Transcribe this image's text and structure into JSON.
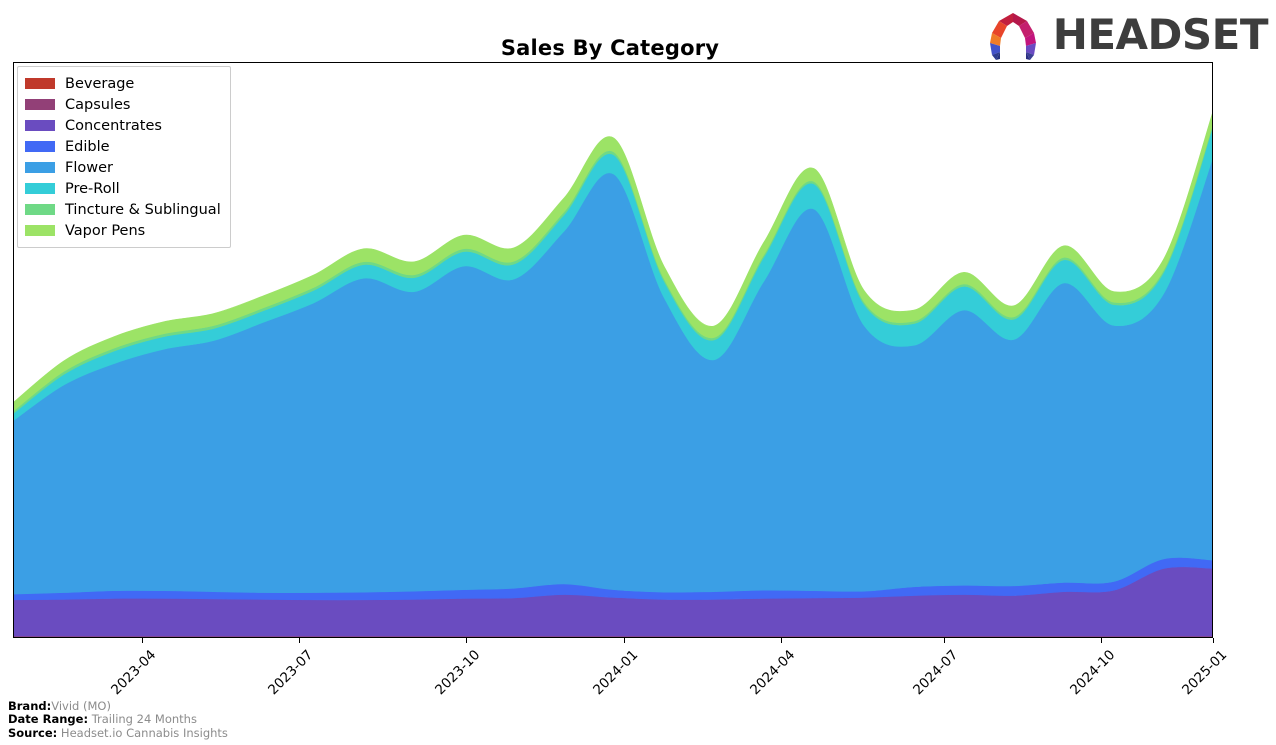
{
  "header": {
    "title": "Sales By Category",
    "logo_word": "HEADSET",
    "logo_icon": "headset-arch-logo"
  },
  "legend": {
    "position": "top-left",
    "items": [
      {
        "label": "Beverage",
        "color": "#c0392b"
      },
      {
        "label": "Capsules",
        "color": "#924077"
      },
      {
        "label": "Concentrates",
        "color": "#6a4cc0"
      },
      {
        "label": "Edible",
        "color": "#4169f5"
      },
      {
        "label": "Flower",
        "color": "#3b9fe5"
      },
      {
        "label": "Pre-Roll",
        "color": "#34cdd8"
      },
      {
        "label": "Tincture & Sublingual",
        "color": "#6fd986"
      },
      {
        "label": "Vapor Pens",
        "color": "#9ce366"
      }
    ]
  },
  "axis": {
    "x_ticks": [
      {
        "label": "2023-04",
        "pos": 0.1072
      },
      {
        "label": "2023-07",
        "pos": 0.2383
      },
      {
        "label": "2023-10",
        "pos": 0.3778
      },
      {
        "label": "2024-01",
        "pos": 0.5089
      },
      {
        "label": "2024-04",
        "pos": 0.64
      },
      {
        "label": "2024-07",
        "pos": 0.7756
      },
      {
        "label": "2024-10",
        "pos": 0.9067
      },
      {
        "label": "2025-01",
        "pos": 1.0
      }
    ],
    "y_labels_visible": false,
    "grid": false
  },
  "footer": {
    "rows": [
      {
        "key": "Brand:",
        "value": "Vivid (MO)"
      },
      {
        "key": "Date Range:",
        "value": "Trailing 24 Months"
      },
      {
        "key": "Source:",
        "value": "Headset.io Cannabis Insights"
      }
    ]
  },
  "chart_data": {
    "type": "area",
    "stacked": true,
    "smoothing": "spline",
    "title": "Sales By Category",
    "xlabel": "",
    "ylabel": "",
    "ylim": [
      0,
      100
    ],
    "axis_values_hidden": true,
    "x": [
      "2023-01",
      "2023-02",
      "2023-03",
      "2023-04",
      "2023-05",
      "2023-06",
      "2023-07",
      "2023-08",
      "2023-09",
      "2023-10",
      "2023-11",
      "2023-12",
      "2024-01",
      "2024-02",
      "2024-03",
      "2024-04",
      "2024-05",
      "2024-06",
      "2024-07",
      "2024-08",
      "2024-09",
      "2024-10",
      "2024-11",
      "2024-12",
      "2025-01"
    ],
    "series": [
      {
        "name": "Beverage",
        "color": "#c0392b",
        "values": [
          0.4,
          0.4,
          0.4,
          0.4,
          0.4,
          0.4,
          0.4,
          0.4,
          0.4,
          0.4,
          0.4,
          0.4,
          0.4,
          0.4,
          0.4,
          0.4,
          0.4,
          0.4,
          0.4,
          0.4,
          0.4,
          0.4,
          0.4,
          0.4,
          0.4
        ]
      },
      {
        "name": "Capsules",
        "color": "#924077",
        "values": [
          0.2,
          0.2,
          0.2,
          0.2,
          0.2,
          0.2,
          0.2,
          0.2,
          0.2,
          0.2,
          0.2,
          0.2,
          0.2,
          0.2,
          0.2,
          0.2,
          0.2,
          0.2,
          0.2,
          0.2,
          0.2,
          0.2,
          0.2,
          0.2,
          0.2
        ]
      },
      {
        "name": "Concentrates",
        "color": "#6a4cc0",
        "values": [
          7.5,
          7.6,
          7.8,
          7.8,
          7.7,
          7.6,
          7.5,
          7.5,
          7.6,
          7.8,
          7.9,
          8.6,
          8.0,
          7.6,
          7.6,
          7.8,
          7.9,
          8.0,
          8.4,
          8.6,
          8.4,
          9.2,
          9.5,
          14.0,
          14.0
        ]
      },
      {
        "name": "Edible",
        "color": "#4169f5",
        "values": [
          1.2,
          1.4,
          1.6,
          1.6,
          1.5,
          1.4,
          1.5,
          1.6,
          1.7,
          1.8,
          2.0,
          2.2,
          1.6,
          1.5,
          1.6,
          1.7,
          1.5,
          1.3,
          1.8,
          1.9,
          2.0,
          1.9,
          1.8,
          2.0,
          1.7
        ]
      },
      {
        "name": "Flower",
        "color": "#3b9fe5",
        "values": [
          36.0,
          43.0,
          47.0,
          50.0,
          52.0,
          56.0,
          60.0,
          65.0,
          62.0,
          67.0,
          64.0,
          73.0,
          86.0,
          61.0,
          48.0,
          64.0,
          79.0,
          55.0,
          50.0,
          57.0,
          51.0,
          62.0,
          53.0,
          55.0,
          84.0
        ]
      },
      {
        "name": "Pre-Roll",
        "color": "#34cdd8",
        "values": [
          1.5,
          2.2,
          2.6,
          2.6,
          2.5,
          2.4,
          2.6,
          2.8,
          2.9,
          3.0,
          3.1,
          3.4,
          4.0,
          3.4,
          4.1,
          5.0,
          5.2,
          4.4,
          4.5,
          4.9,
          4.2,
          4.8,
          4.3,
          4.4,
          6.5
        ]
      },
      {
        "name": "Tincture & Sublingual",
        "color": "#6fd986",
        "values": [
          0.5,
          0.6,
          0.6,
          0.6,
          0.6,
          0.6,
          0.6,
          0.6,
          0.6,
          0.6,
          0.6,
          0.6,
          0.6,
          0.5,
          0.5,
          0.5,
          0.5,
          0.5,
          0.5,
          0.5,
          0.5,
          0.5,
          0.5,
          0.5,
          0.5
        ]
      },
      {
        "name": "Vapor Pens",
        "color": "#9ce366",
        "values": [
          1.8,
          2.2,
          2.4,
          2.5,
          2.5,
          2.5,
          2.6,
          2.7,
          2.7,
          2.8,
          2.8,
          2.9,
          2.9,
          2.6,
          2.4,
          2.6,
          2.7,
          2.4,
          2.3,
          2.4,
          2.3,
          2.4,
          2.2,
          2.3,
          2.6
        ]
      }
    ]
  }
}
